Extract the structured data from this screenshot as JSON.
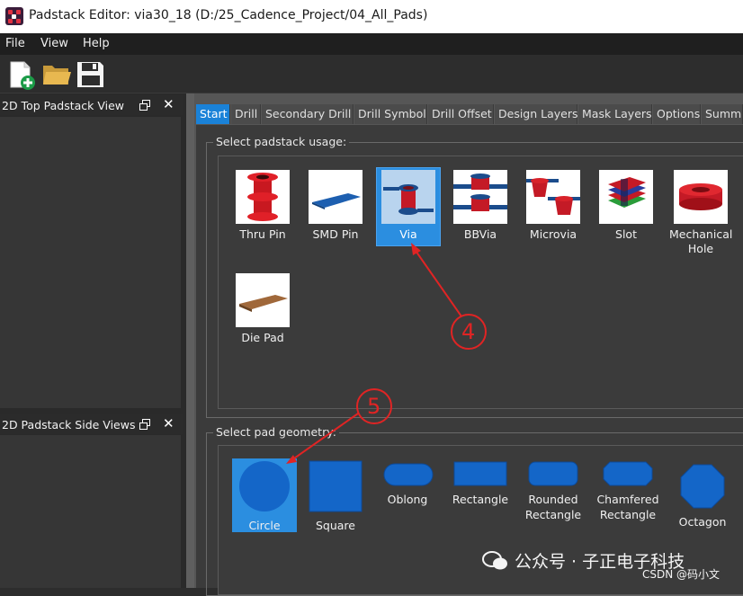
{
  "window": {
    "title": "Padstack Editor: via30_18  (D:/25_Cadence_Project/04_All_Pads)"
  },
  "menu": {
    "items": [
      "File",
      "View",
      "Help"
    ]
  },
  "toolbar": {
    "buttons": [
      {
        "icon": "new-file-icon"
      },
      {
        "icon": "open-folder-icon"
      },
      {
        "icon": "save-icon"
      }
    ]
  },
  "docks": {
    "top_view": {
      "title": "2D Top Padstack View"
    },
    "side_views": {
      "title": "2D Padstack Side Views"
    }
  },
  "tabs": [
    "Start",
    "Drill",
    "Secondary Drill",
    "Drill Symbol",
    "Drill Offset",
    "Design Layers",
    "Mask Layers",
    "Options",
    "Summa"
  ],
  "active_tab": "Start",
  "usage": {
    "label": "Select padstack usage:",
    "items": [
      {
        "label": "Thru Pin"
      },
      {
        "label": "SMD Pin"
      },
      {
        "label": "Via",
        "selected": true
      },
      {
        "label": "BBVia"
      },
      {
        "label": "Microvia"
      },
      {
        "label": "Slot"
      },
      {
        "label": "Mechanical\nHole"
      },
      {
        "label": "Die Pad"
      }
    ]
  },
  "geometry": {
    "label": "Select pad geometry:",
    "items": [
      {
        "label": "Circle",
        "selected": true
      },
      {
        "label": "Square"
      },
      {
        "label": "Oblong"
      },
      {
        "label": "Rectangle"
      },
      {
        "label": "Rounded\nRectangle"
      },
      {
        "label": "Chamfered\nRectangle"
      },
      {
        "label": "Octagon"
      }
    ]
  },
  "annotations": {
    "step4": "4",
    "step5": "5"
  },
  "watermark": {
    "text": "公众号 · 子正电子科技",
    "credit": "CSDN @码小文"
  },
  "colors": {
    "accent": "#1a82d8",
    "annotation": "#e02424",
    "pad_blue": "#1160c8",
    "copper_red": "#d81c24"
  }
}
